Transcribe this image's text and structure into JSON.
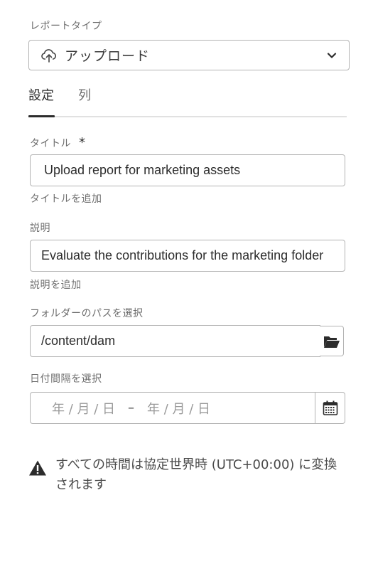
{
  "report_type": {
    "label": "レポートタイプ",
    "selected": "アップロード"
  },
  "tabs": [
    {
      "label": "設定",
      "active": true
    },
    {
      "label": "列",
      "active": false
    }
  ],
  "title_field": {
    "label": "タイトル",
    "required_mark": "*",
    "value": "Upload report for marketing assets",
    "help": "タイトルを追加"
  },
  "description_field": {
    "label": "説明",
    "value": "Evaluate the contributions for the marketing folder",
    "help": "説明を追加"
  },
  "folder_path_field": {
    "label": "フォルダーのパスを選択",
    "value": "/content/dam"
  },
  "date_range_field": {
    "label": "日付間隔を選択",
    "start_placeholder": "年 / 月 / 日",
    "separator": "–",
    "end_placeholder": "年 / 月 / 日"
  },
  "alert": {
    "message": "すべての時間は協定世界時 (UTC+00:00) に変換されます"
  }
}
